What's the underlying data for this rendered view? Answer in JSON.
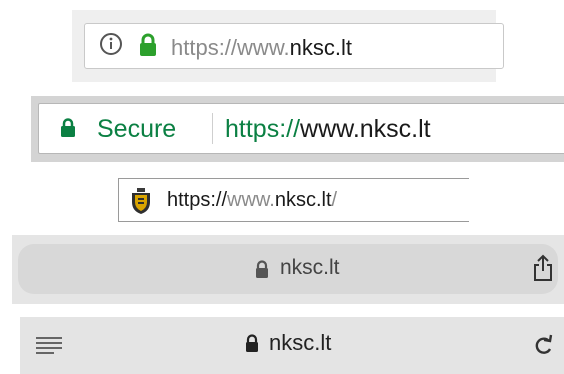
{
  "bars": {
    "firefox": {
      "url_scheme": "https://",
      "url_sub": "www.",
      "url_domain": "nksc.lt",
      "icons": [
        "info-icon",
        "lock-icon"
      ],
      "lock_color": "#2ca02c"
    },
    "chrome": {
      "secure_label": "Secure",
      "url_scheme": "https://",
      "url_rest": "www.nksc.lt",
      "secure_color": "#0b8043",
      "icons": [
        "lock-icon"
      ]
    },
    "edge": {
      "url_scheme": "https://",
      "url_sub": "www.",
      "url_domain": "nksc.lt",
      "url_trailing": "/",
      "icons": [
        "site-badge-icon"
      ]
    },
    "safari_ios": {
      "domain": "nksc.lt",
      "icons": [
        "lock-icon",
        "share-icon"
      ]
    },
    "safari_mac": {
      "domain": "nksc.lt",
      "icons": [
        "reader-menu-icon",
        "lock-icon",
        "reload-icon"
      ]
    }
  }
}
